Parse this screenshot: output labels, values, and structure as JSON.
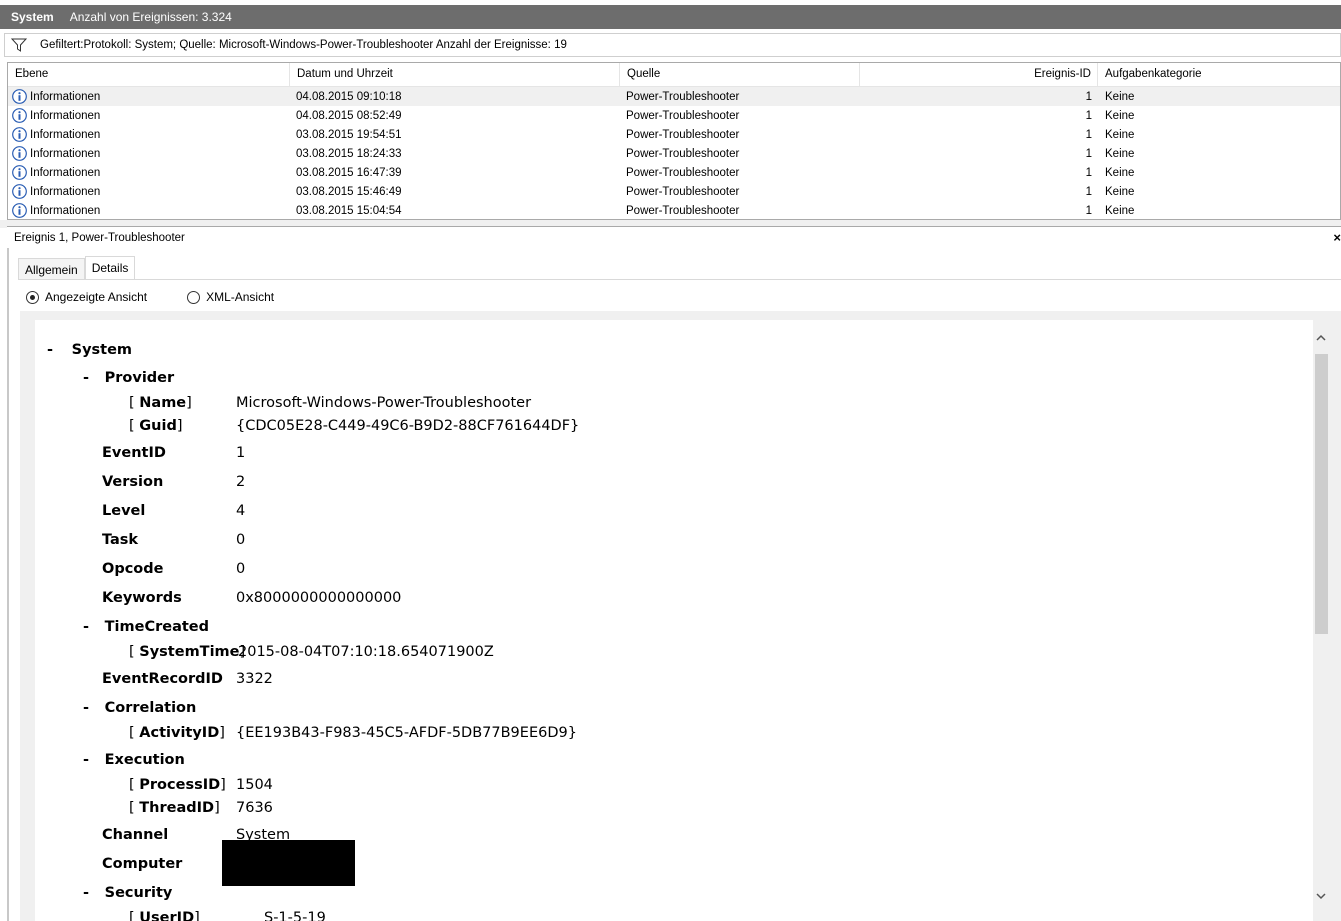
{
  "titlebar": {
    "name": "System",
    "count": "Anzahl von Ereignissen: 3.324"
  },
  "filter": {
    "icon": "filter-funnel-icon",
    "text": "Gefiltert:Protokoll: System; Quelle: Microsoft-Windows-Power-Troubleshooter Anzahl der Ereignisse: 19"
  },
  "table": {
    "headers": [
      "Ebene",
      "Datum und Uhrzeit",
      "Quelle",
      "Ereignis-ID",
      "Aufgabenkategorie"
    ],
    "rows": [
      {
        "level": "Informationen",
        "datetime": "04.08.2015 09:10:18",
        "source": "Power-Troubleshooter",
        "id": "1",
        "category": "Keine"
      },
      {
        "level": "Informationen",
        "datetime": "04.08.2015 08:52:49",
        "source": "Power-Troubleshooter",
        "id": "1",
        "category": "Keine"
      },
      {
        "level": "Informationen",
        "datetime": "03.08.2015 19:54:51",
        "source": "Power-Troubleshooter",
        "id": "1",
        "category": "Keine"
      },
      {
        "level": "Informationen",
        "datetime": "03.08.2015 18:24:33",
        "source": "Power-Troubleshooter",
        "id": "1",
        "category": "Keine"
      },
      {
        "level": "Informationen",
        "datetime": "03.08.2015 16:47:39",
        "source": "Power-Troubleshooter",
        "id": "1",
        "category": "Keine"
      },
      {
        "level": "Informationen",
        "datetime": "03.08.2015 15:46:49",
        "source": "Power-Troubleshooter",
        "id": "1",
        "category": "Keine"
      },
      {
        "level": "Informationen",
        "datetime": "03.08.2015 15:04:54",
        "source": "Power-Troubleshooter",
        "id": "1",
        "category": "Keine"
      }
    ]
  },
  "detail": {
    "title": "Ereignis 1, Power-Troubleshooter",
    "close": "×",
    "tabs": [
      "Allgemein",
      "Details"
    ],
    "view_options": [
      "Angezeigte Ansicht",
      "XML-Ansicht"
    ]
  },
  "xml": {
    "dash": "-",
    "bracket_open": "[",
    "bracket_close": "]",
    "system": "System",
    "provider": "Provider",
    "name_key": "Name",
    "name_val": "Microsoft-Windows-Power-Troubleshooter",
    "guid_key": "Guid",
    "guid_val": "{CDC05E28-C449-49C6-B9D2-88CF761644DF}",
    "eventid_key": "EventID",
    "eventid_val": "1",
    "version_key": "Version",
    "version_val": "2",
    "level_key": "Level",
    "level_val": "4",
    "task_key": "Task",
    "task_val": "0",
    "opcode_key": "Opcode",
    "opcode_val": "0",
    "keywords_key": "Keywords",
    "keywords_val": "0x8000000000000000",
    "timecreated": "TimeCreated",
    "systemtime_key": "SystemTime",
    "systemtime_val": "2015-08-04T07:10:18.654071900Z",
    "eventrecordid_key": "EventRecordID",
    "eventrecordid_val": "3322",
    "correlation": "Correlation",
    "activityid_key": "ActivityID",
    "activityid_val": "{EE193B43-F983-45C5-AFDF-5DB77B9EE6D9}",
    "execution": "Execution",
    "processid_key": "ProcessID",
    "processid_val": "1504",
    "threadid_key": "ThreadID",
    "threadid_val": "7636",
    "channel_key": "Channel",
    "channel_val": "System",
    "computer_key": "Computer",
    "security": "Security",
    "userid_key": "UserID",
    "userid_val": "S-1-5-19"
  }
}
